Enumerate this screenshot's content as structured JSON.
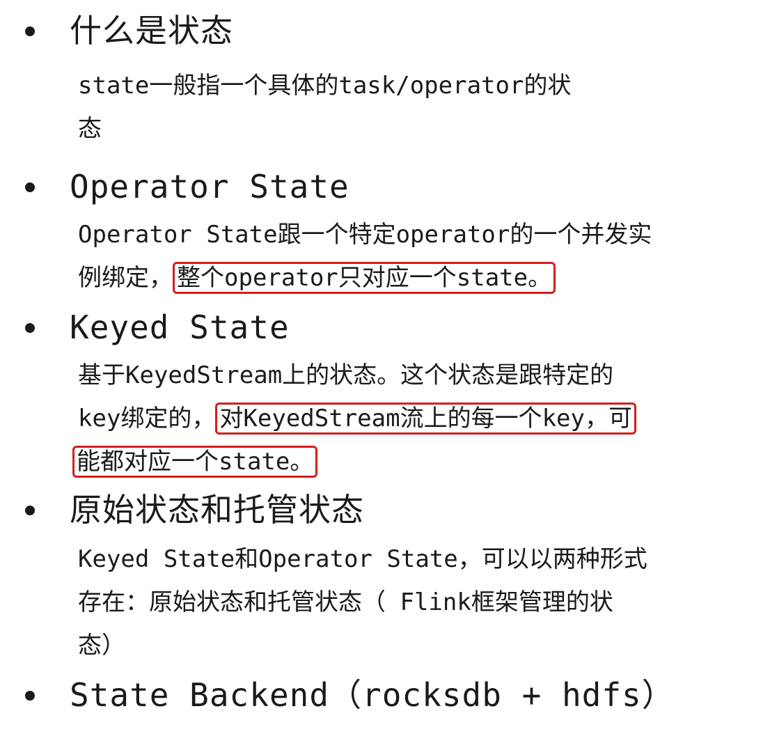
{
  "sections": [
    {
      "title": "什么是状态",
      "lines": [
        [
          "state一般指一个具体的task/operator的状"
        ],
        [
          "态"
        ]
      ]
    },
    {
      "title": "Operator State",
      "lines": [
        [
          "Operator State跟一个特定operator的一个并发实"
        ],
        [
          "例绑定，",
          "整个operator只对应一个state。"
        ]
      ]
    },
    {
      "title": "Keyed State",
      "lines": [
        [
          "基于KeyedStream上的状态。这个状态是跟特定的"
        ],
        [
          "key绑定的，",
          "对KeyedStream流上的每一个key，可"
        ],
        [
          "能都对应一个state。"
        ]
      ]
    },
    {
      "title": "原始状态和托管状态",
      "lines": [
        [
          "Keyed State和Operator State，可以以两种形式"
        ],
        [
          "存在：原始状态和托管状态（ Flink框架管理的状"
        ],
        [
          "态）"
        ]
      ]
    },
    {
      "title": "State Backend（rocksdb + hdfs）",
      "lines": []
    }
  ],
  "highlight_color": "#d21e1e"
}
